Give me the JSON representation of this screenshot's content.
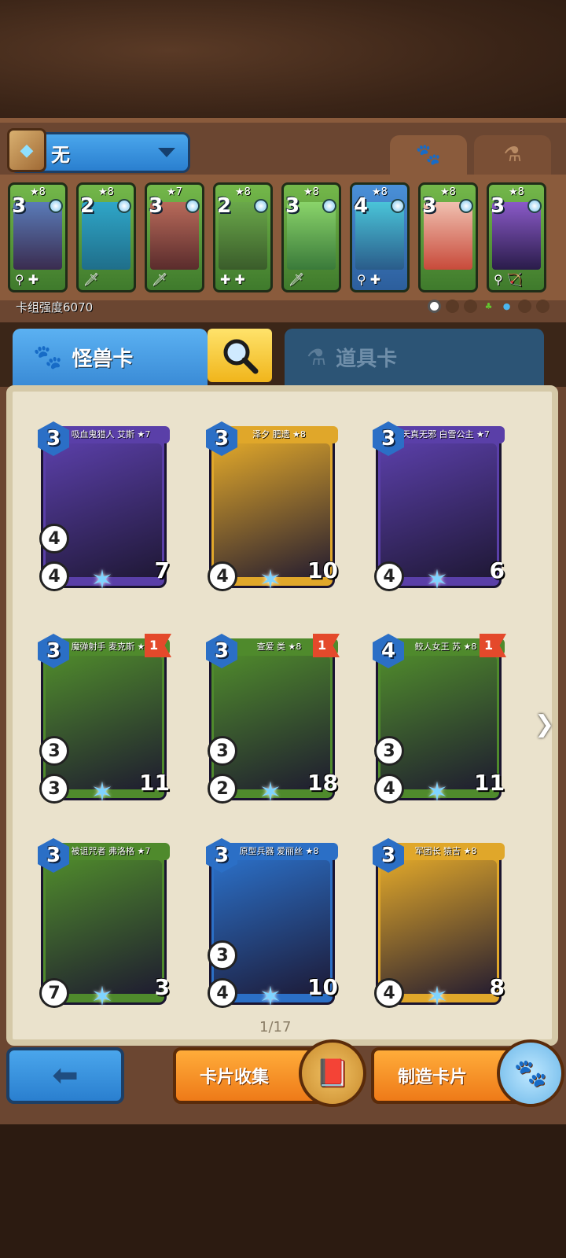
{
  "header": {
    "deck_name": "无",
    "deck_power": "卡组强度6070",
    "tab_monster_icon": "paw-icon",
    "tab_item_icon": "potion-icon"
  },
  "deck": [
    {
      "stars": "★8",
      "cost": "3",
      "color": "green"
    },
    {
      "stars": "★8",
      "cost": "2",
      "color": "green"
    },
    {
      "stars": "★7",
      "cost": "3",
      "color": "green"
    },
    {
      "stars": "★8",
      "cost": "2",
      "color": "green"
    },
    {
      "stars": "★8",
      "cost": "3",
      "color": "green"
    },
    {
      "stars": "★8",
      "cost": "4",
      "color": "blue"
    },
    {
      "stars": "★8",
      "cost": "3",
      "color": "green"
    },
    {
      "stars": "★8",
      "cost": "3",
      "color": "green"
    }
  ],
  "tabs": {
    "monster": "怪兽卡",
    "items": "道具卡"
  },
  "cards": [
    {
      "name": "吸血鬼猎人 艾斯 ★7",
      "cost": "3",
      "s1": "4",
      "s2": "4",
      "hp": "7",
      "color": "#5a3fa8"
    },
    {
      "name": "泽夕 肥遗 ★8",
      "cost": "3",
      "s1": "",
      "s2": "4",
      "hp": "10",
      "color": "#e0a72a"
    },
    {
      "name": "天真无邪 白雪公主 ★7",
      "cost": "3",
      "s1": "",
      "s2": "4",
      "hp": "6",
      "color": "#5a3fa8"
    },
    {
      "name": "魔弹射手 麦克斯 ★8",
      "cost": "3",
      "s1": "3",
      "s2": "3",
      "hp": "11",
      "color": "#4f8a2c",
      "flag": "1"
    },
    {
      "name": "查爱 类 ★8",
      "cost": "3",
      "s1": "3",
      "s2": "2",
      "hp": "18",
      "color": "#4f8a2c",
      "flag": "1"
    },
    {
      "name": "鲛人女王 苏 ★8",
      "cost": "4",
      "s1": "3",
      "s2": "4",
      "hp": "11",
      "color": "#4f8a2c",
      "flag": "1"
    },
    {
      "name": "被诅咒者 弗洛格 ★7",
      "cost": "3",
      "s1": "",
      "s2": "7",
      "hp": "3",
      "color": "#4f8a2c"
    },
    {
      "name": "原型兵器 爱丽丝 ★8",
      "cost": "3",
      "s1": "3",
      "s2": "4",
      "hp": "10",
      "color": "#2b6fc6"
    },
    {
      "name": "军团长 猿吉 ★8",
      "cost": "3",
      "s1": "",
      "s2": "4",
      "hp": "8",
      "color": "#e0a72a"
    }
  ],
  "pagination": "1/17",
  "buttons": {
    "back_icon": "back-arrow-icon",
    "collect": "卡片收集",
    "craft": "制造卡片"
  }
}
